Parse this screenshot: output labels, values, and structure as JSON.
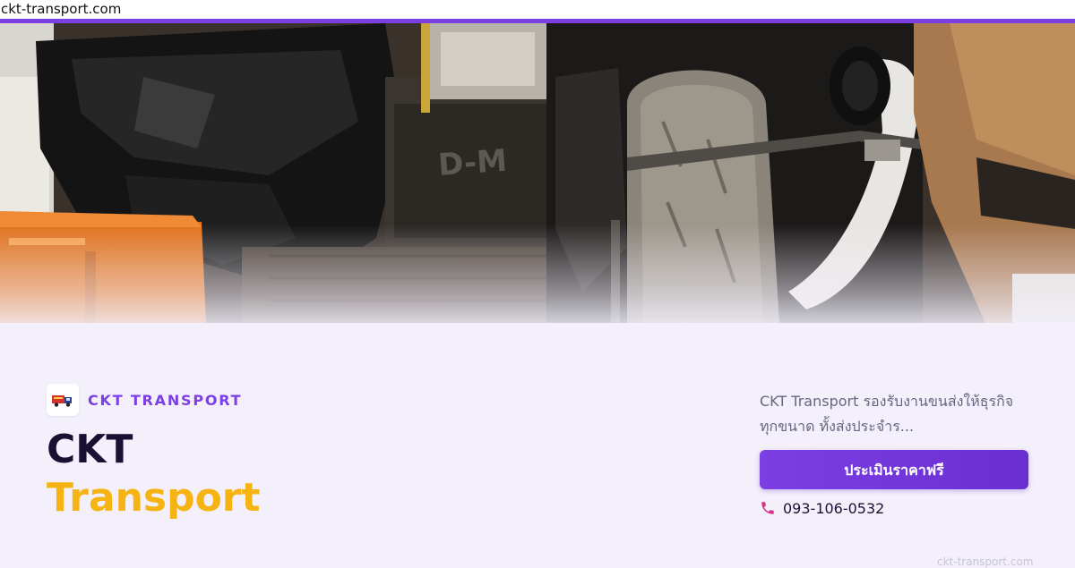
{
  "browser": {
    "url": "ckt-transport.com"
  },
  "colors": {
    "accent": "#7b3fe4",
    "title_dark": "#1a1033",
    "title_gold": "#f5b412",
    "background": "#f3f0fb",
    "phone_icon": "#d63384"
  },
  "hero": {
    "image_subject": "motorcycle-strapped-in-truck-photo"
  },
  "brand": {
    "name": "CKT TRANSPORT",
    "logo_icon": "truck-logo-icon"
  },
  "title": {
    "line1": "CKT",
    "line2": "Transport"
  },
  "description": "CKT Transport รองรับงานขนส่งให้ธุรกิจทุกขนาด ทั้งส่งประจำร...",
  "cta": {
    "label": "ประเมินราคาฟรี"
  },
  "contact": {
    "phone": "093-106-0532",
    "phone_icon": "phone-icon"
  },
  "footer": {
    "watermark": "ckt-transport.com"
  }
}
